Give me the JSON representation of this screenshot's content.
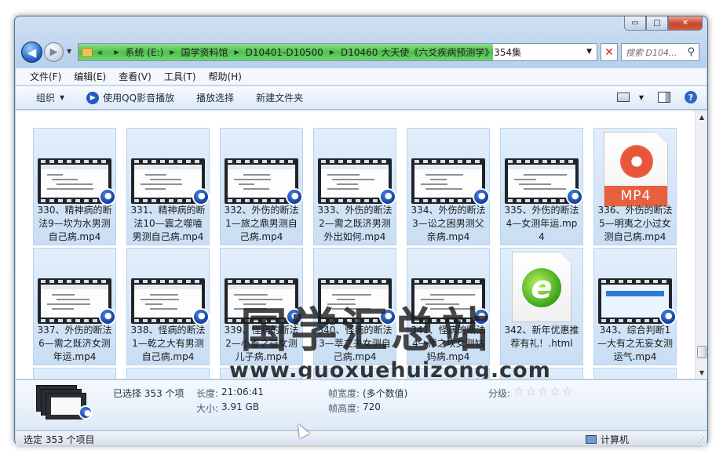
{
  "window": {
    "controls": {
      "minimize": "▭",
      "maximize": "□",
      "close": "✕"
    }
  },
  "nav": {
    "back_glyph": "◀",
    "forward_glyph": "▶",
    "dropdown_glyph": "▼",
    "refresh_glyph": "✕"
  },
  "address": {
    "lead": "«",
    "crumbs": [
      "系统 (E:)",
      "国学资料馆",
      "D10401-D10500",
      "D10460 大天使《六爻疾病预测学》354集"
    ],
    "progress_percent": 80
  },
  "search": {
    "placeholder": "搜索 D104...",
    "icon": "search-icon"
  },
  "menu": [
    "文件(F)",
    "编辑(E)",
    "查看(V)",
    "工具(T)",
    "帮助(H)"
  ],
  "toolbar": {
    "organize": "组织",
    "qq_play": "使用QQ影音播放",
    "playlist": "播放选择",
    "new_folder": "新建文件夹"
  },
  "files": [
    {
      "label": "330、精神病的断法9—坎为水男测自己病.mp4",
      "type": "video"
    },
    {
      "label": "331、精神病的断法10—震之噬嗑男测自己病.mp4",
      "type": "video"
    },
    {
      "label": "332、外伤的断法1—旅之鼎男测自己病.mp4",
      "type": "video"
    },
    {
      "label": "333、外伤的断法2—需之既济男测外出如何.mp4",
      "type": "video"
    },
    {
      "label": "334、外伤的断法3—讼之困男测父亲病.mp4",
      "type": "video"
    },
    {
      "label": "335、外伤的断法4—女测年运.mp4",
      "type": "video"
    },
    {
      "label": "336、外伤的断法5—明夷之小过女测自己病.mp4",
      "type": "mp4"
    },
    {
      "label": "337、外伤的断法6—需之既济女测年运.mp4",
      "type": "video"
    },
    {
      "label": "338、怪病的断法1—乾之大有男测自己病.mp4",
      "type": "video"
    },
    {
      "label": "339、怪病的断法2—小畜之益女测儿子病.mp4",
      "type": "video"
    },
    {
      "label": "340、怪病的断法3—萃之夬女测自己病.mp4",
      "type": "video"
    },
    {
      "label": "341、怪病的断法4—师之坎女测姑妈病.mp4",
      "type": "video"
    },
    {
      "label": "342、新年优惠推荐有礼！.html",
      "type": "html"
    },
    {
      "label": "343、综合判断1—大有之无妄女测运气.mp4",
      "type": "brand"
    }
  ],
  "mp4_badge": "MP4",
  "watermark": {
    "main": "国学汇总站",
    "url": "www.guoxuehuizong.com"
  },
  "details": {
    "selected": "已选择 353 个项",
    "length_key": "长度:",
    "length_val": "21:06:41",
    "size_key": "大小:",
    "size_val": "3.91 GB",
    "width_key": "帧宽度:",
    "width_val": "(多个数值)",
    "height_key": "帧高度:",
    "height_val": "720",
    "rating_key": "分级:",
    "rating_stars": "☆☆☆☆☆"
  },
  "status": {
    "left": "选定 353 个项目",
    "right": "计算机"
  }
}
